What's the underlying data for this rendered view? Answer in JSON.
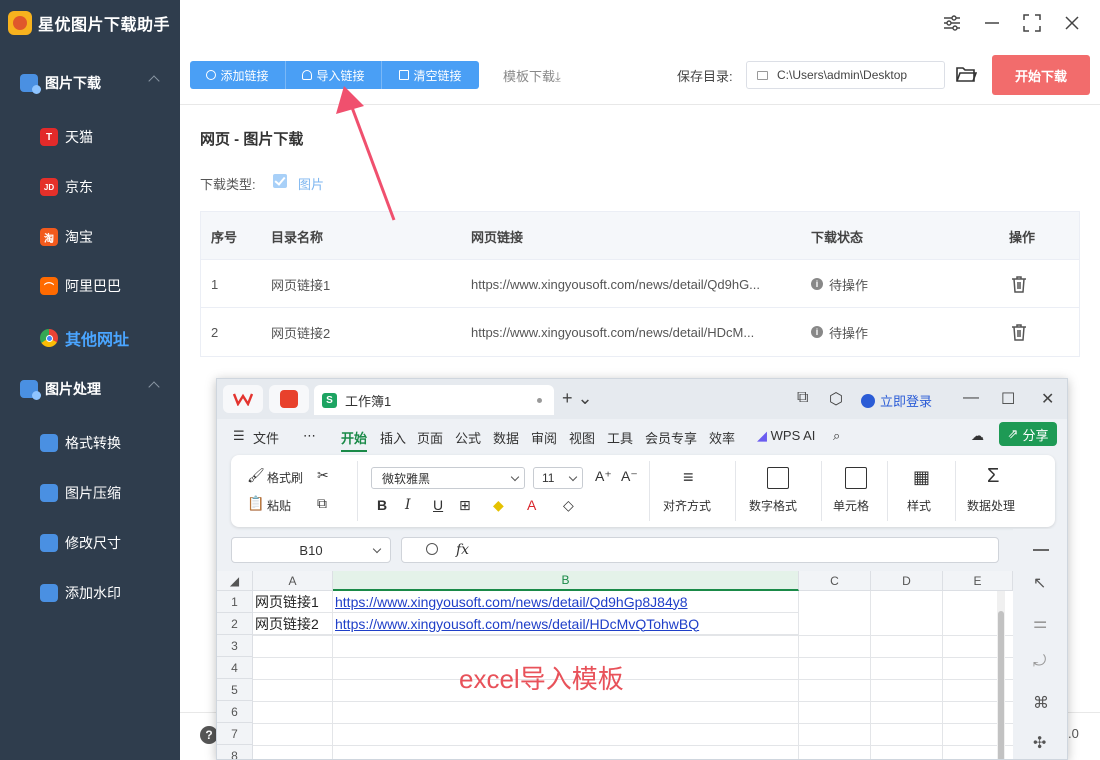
{
  "app": {
    "title": "星优图片下载助手"
  },
  "sidebar": {
    "groups": [
      {
        "label": "图片下载",
        "items": [
          {
            "label": "天猫",
            "icon": "tmall-icon",
            "badge": "T",
            "color": "#e22a2a"
          },
          {
            "label": "京东",
            "icon": "jd-icon",
            "badge": "JD",
            "color": "#e5302a"
          },
          {
            "label": "淘宝",
            "icon": "taobao-icon",
            "badge": "淘",
            "color": "#f25a1d"
          },
          {
            "label": "阿里巴巴",
            "icon": "alibaba-icon",
            "badge": "⌒",
            "color": "#ff6a00"
          },
          {
            "label": "其他网址",
            "icon": "chrome-icon",
            "badge": "",
            "color": "#ffffff"
          }
        ]
      },
      {
        "label": "图片处理",
        "items": [
          {
            "label": "格式转换",
            "icon": "format-convert-icon",
            "badge": "",
            "color": "#4a90e2"
          },
          {
            "label": "图片压缩",
            "icon": "compress-icon",
            "badge": "",
            "color": "#4a90e2"
          },
          {
            "label": "修改尺寸",
            "icon": "resize-icon",
            "badge": "",
            "color": "#4a90e2"
          },
          {
            "label": "添加水印",
            "icon": "watermark-icon",
            "badge": "",
            "color": "#4a90e2"
          }
        ]
      }
    ],
    "active": "其他网址"
  },
  "toolbar": {
    "add_link": "添加链接",
    "import_link": "导入链接",
    "clear_link": "清空链接",
    "template_download": "模板下载⤓",
    "save_dir_label": "保存目录:",
    "save_dir_value": "C:\\Users\\admin\\Desktop",
    "start_download": "开始下载"
  },
  "main": {
    "title": "网页 - 图片下载",
    "type_label": "下载类型:",
    "type_value": "图片",
    "table": {
      "headers": [
        "序号",
        "目录名称",
        "网页链接",
        "下载状态",
        "操作"
      ],
      "rows": [
        {
          "index": "1",
          "name": "网页链接1",
          "url": "https://www.xingyousoft.com/news/detail/Qd9hG...",
          "status": "待操作"
        },
        {
          "index": "2",
          "name": "网页链接2",
          "url": "https://www.xingyousoft.com/news/detail/HDcM...",
          "status": "待操作"
        }
      ]
    },
    "help": "?",
    "version_fragment": ".0"
  },
  "colors": {
    "sidebar_bg": "#2f3d4d",
    "accent_blue": "#4a9ff5",
    "start_red": "#f26c6c",
    "arrow_pink": "#f0506e",
    "wps_green": "#1a8a48"
  },
  "excel": {
    "doc_tab": "工作簿1",
    "login": "立即登录",
    "menu": [
      "文件",
      "⋯",
      "开始",
      "插入",
      "页面",
      "公式",
      "数据",
      "审阅",
      "视图",
      "工具",
      "会员专享",
      "效率",
      "WPS AI"
    ],
    "active_menu": "开始",
    "share": "分享",
    "ribbon": {
      "format_painter": "格式刷",
      "paste": "粘贴",
      "font": "微软雅黑",
      "font_size": "11",
      "align": "对齐方式",
      "number_format": "数字格式",
      "cell": "单元格",
      "style": "样式",
      "data_process": "数据处理"
    },
    "name_box": "B10",
    "fx": "fx",
    "columns": [
      "A",
      "B",
      "C",
      "D",
      "E"
    ],
    "rows": [
      "1",
      "2",
      "3",
      "4",
      "5",
      "6",
      "7",
      "8"
    ],
    "cells": [
      {
        "a": "网页链接1",
        "b": "https://www.xingyousoft.com/news/detail/Qd9hGp8J84y8"
      },
      {
        "a": "网页链接2",
        "b": "https://www.xingyousoft.com/news/detail/HDcMvQTohwBQ"
      }
    ],
    "overlay_caption": "excel导入模板"
  }
}
